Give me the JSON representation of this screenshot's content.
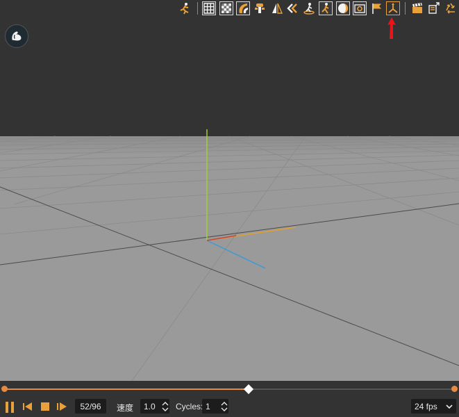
{
  "toolbar": {
    "icons": [
      "running-figure-icon",
      "grid-icon",
      "checkerboard-icon",
      "shading-icon",
      "bones-icon",
      "mirror-icon",
      "rewind-keys-icon",
      "ground-figure-icon",
      "walk-icon",
      "halo-icon",
      "capture-icon",
      "flag-icon",
      "axes-icon",
      "clapperboard-icon",
      "export-film-icon",
      "recycle-icon"
    ]
  },
  "colors": {
    "accent": "#e9a23b",
    "background": "#333333",
    "floor": "#9a9a9a",
    "axis_x": "#e0a030",
    "axis_y": "#9fd03a",
    "axis_z": "#3a9ad8",
    "axis_neg_x": "#d04030",
    "timeline": "#e58a45",
    "annotation_arrow": "#e8141a"
  },
  "timeline": {
    "current_frame": 52,
    "total_frames": 96
  },
  "controls": {
    "frame_counter": "52/96",
    "speed_label": "速度",
    "speed_value": "1.0",
    "cycles_label": "Cycles:",
    "cycles_value": "1",
    "fps_value": "24 fps"
  }
}
